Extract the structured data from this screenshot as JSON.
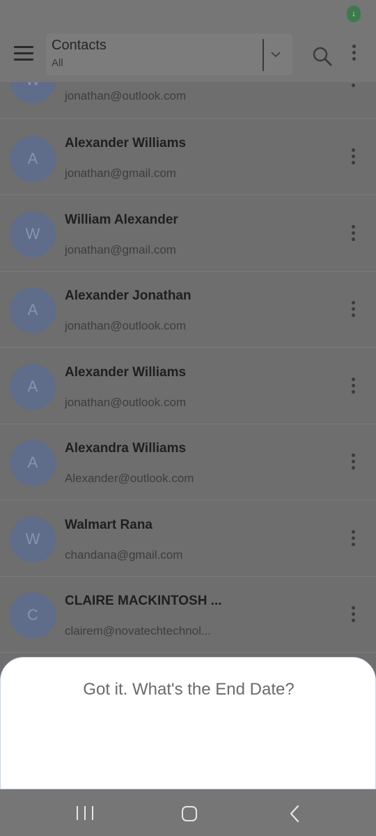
{
  "status_bar": {
    "indicator_glyph": "↓"
  },
  "header": {
    "title": "Contacts",
    "filter": "All"
  },
  "contacts": [
    {
      "initial": "W",
      "name": "",
      "email": "jonathan@outlook.com"
    },
    {
      "initial": "A",
      "name": "Alexander Williams",
      "email": "jonathan@gmail.com"
    },
    {
      "initial": "W",
      "name": "William Alexander",
      "email": "jonathan@gmail.com"
    },
    {
      "initial": "A",
      "name": "Alexander Jonathan",
      "email": "jonathan@outlook.com"
    },
    {
      "initial": "A",
      "name": "Alexander Williams",
      "email": "jonathan@outlook.com"
    },
    {
      "initial": "A",
      "name": "Alexandra Williams",
      "email": "Alexander@outlook.com"
    },
    {
      "initial": "W",
      "name": "Walmart Rana",
      "email": "chandana@gmail.com"
    },
    {
      "initial": "C",
      "name": "CLAIRE MACKINTOSH ...",
      "email": "clairem@novatechtechnol..."
    }
  ],
  "sheet": {
    "prompt": "Got it. What's the End Date?"
  },
  "colors": {
    "overlay": "#6e6e6e",
    "avatar": "#5f6c8a",
    "sheet": "#ffffff"
  }
}
